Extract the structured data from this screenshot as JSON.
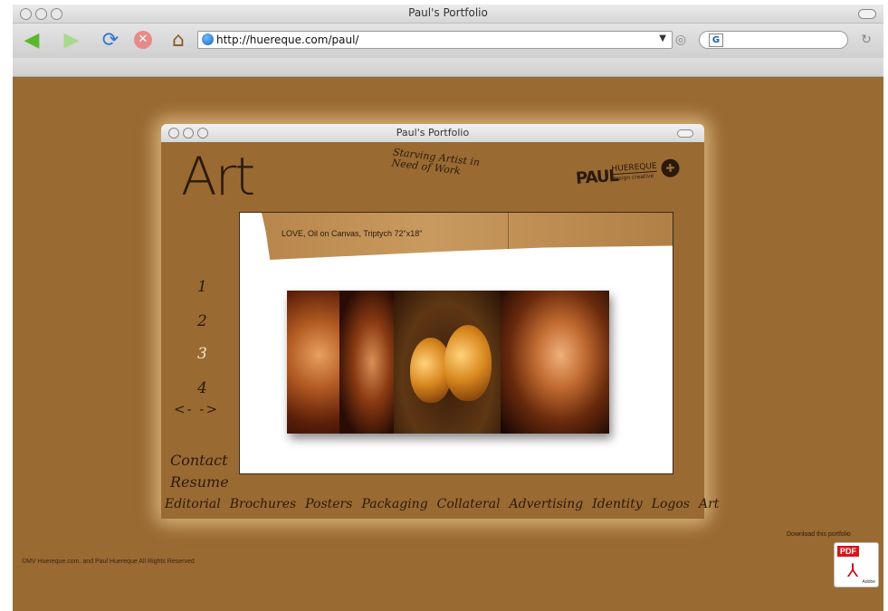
{
  "browser": {
    "window_title": "Paul's Portfolio",
    "url": "http://huereque.com/paul/",
    "search_engine_icon": "G",
    "icons": [
      "back-icon",
      "forward-icon",
      "reload-icon",
      "stop-icon",
      "home-icon",
      "globe-icon",
      "dropdown-icon",
      "rss-icon",
      "google-icon",
      "snapback-icon"
    ]
  },
  "site": {
    "window_title": "Paul's Portfolio",
    "heading": "Art",
    "tagline": "Starving Artist in Need of Work",
    "logo_name": "PAUL",
    "logo_company": "HUEREQUE",
    "logo_subtitle": "design creative",
    "caption": "LOVE, Oil on Canvas, Triptych 72\"x18\"",
    "page_numbers": [
      "1",
      "2",
      "3",
      "4"
    ],
    "active_page": "3",
    "prev_next": "<- ->",
    "side_links": [
      "Contact",
      "Resume"
    ],
    "categories": [
      "Editorial",
      "Brochures",
      "Posters",
      "Packaging",
      "Collateral",
      "Advertising",
      "Identity",
      "Logos",
      "Art"
    ],
    "copyright": "©MV Huereque.com. and Paul Huereque All Rights Reserved",
    "download_text": "Download this portfolio",
    "pdf_label": "PDF",
    "pdf_brand": "Adobe"
  },
  "colors": {
    "page_background": "#9a6a33",
    "ink": "#2a1a0c",
    "active_nav": "#f3e6cc"
  }
}
